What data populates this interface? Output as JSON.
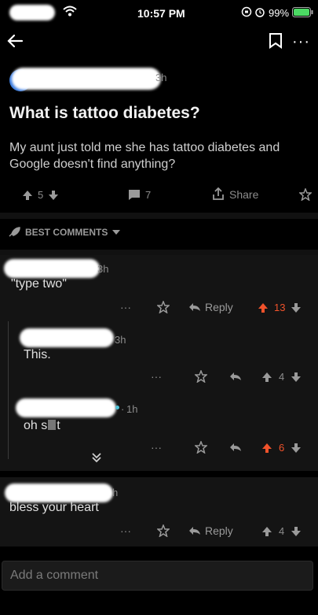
{
  "status": {
    "time": "10:57 PM",
    "battery": "99%"
  },
  "post": {
    "title": "What is tattoo diabetes?",
    "body": "My aunt just told me she has tattoo diabetes and Google doesn't find anything?",
    "author_suffix": "3h",
    "upvotes": "5",
    "comments": "7",
    "share_label": "Share"
  },
  "sort": {
    "label": "BEST COMMENTS"
  },
  "comments": [
    {
      "time": "3h",
      "text": "\"type two\"",
      "reply_label": "Reply",
      "votes": "13",
      "vote_color": "#f0522b"
    },
    {
      "time": "3h",
      "text": "This.",
      "votes": "4"
    },
    {
      "time": "1h",
      "text": "oh s  t",
      "votes": "6",
      "vote_color": "#f0522b"
    },
    {
      "time": "h",
      "text": "bless your heart",
      "reply_label": "Reply",
      "votes": "4"
    }
  ],
  "composer": {
    "placeholder": "Add a comment"
  },
  "icons": [
    "back-arrow-icon",
    "bookmark-icon",
    "more-icon",
    "upvote-icon",
    "downvote-icon",
    "comment-icon",
    "share-icon",
    "award-icon",
    "rocket-icon",
    "reply-icon",
    "collapse-icon"
  ]
}
